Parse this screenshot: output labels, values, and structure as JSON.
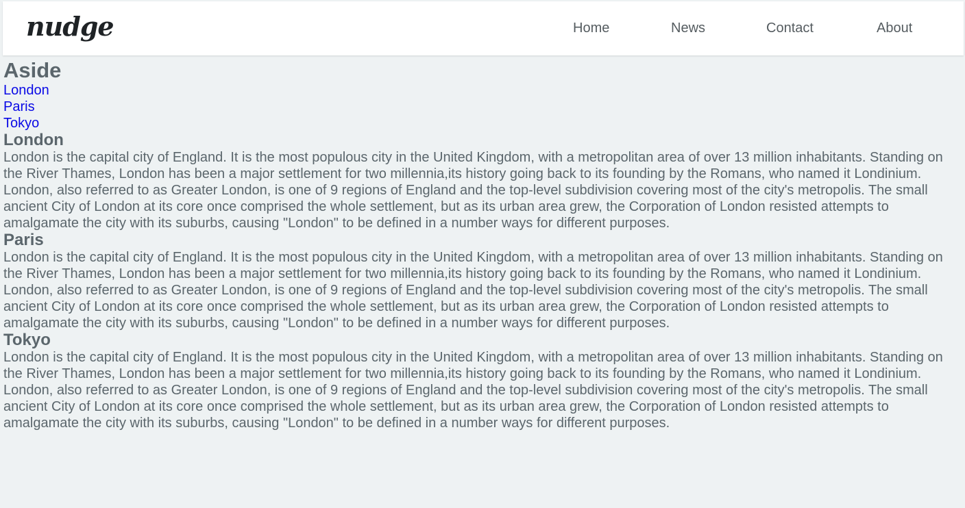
{
  "header": {
    "logo": "nudge",
    "nav": [
      "Home",
      "News",
      "Contact",
      "About"
    ]
  },
  "aside": {
    "title": "Aside",
    "links": [
      "London",
      "Paris",
      "Tokyo"
    ]
  },
  "sections": [
    {
      "title": "London",
      "paragraphs": [
        "London is the capital city of England. It is the most populous city in the United Kingdom, with a metropolitan area of over 13 million inhabitants. Standing on the River Thames, London has been a major settlement for two millennia,its history going back to its founding by the Romans, who named it Londinium.",
        "London, also referred to as Greater London, is one of 9 regions of England and the top-level subdivision covering most of the city's metropolis. The small ancient City of London at its core once comprised the whole settlement, but as its urban area grew, the Corporation of London resisted attempts to amalgamate the city with its suburbs, causing \"London\" to be defined in a number ways for different purposes."
      ]
    },
    {
      "title": "Paris",
      "paragraphs": [
        "London is the capital city of England. It is the most populous city in the United Kingdom, with a metropolitan area of over 13 million inhabitants. Standing on the River Thames, London has been a major settlement for two millennia,its history going back to its founding by the Romans, who named it Londinium.",
        "London, also referred to as Greater London, is one of 9 regions of England and the top-level subdivision covering most of the city's metropolis. The small ancient City of London at its core once comprised the whole settlement, but as its urban area grew, the Corporation of London resisted attempts to amalgamate the city with its suburbs, causing \"London\" to be defined in a number ways for different purposes."
      ]
    },
    {
      "title": "Tokyo",
      "paragraphs": [
        "London is the capital city of England. It is the most populous city in the United Kingdom, with a metropolitan area of over 13 million inhabitants. Standing on the River Thames, London has been a major settlement for two millennia,its history going back to its founding by the Romans, who named it Londinium.",
        "London, also referred to as Greater London, is one of 9 regions of England and the top-level subdivision covering most of the city's metropolis. The small ancient City of London at its core once comprised the whole settlement, but as its urban area grew, the Corporation of London resisted attempts to amalgamate the city with its suburbs, causing \"London\" to be defined in a number ways for different purposes."
      ]
    }
  ]
}
